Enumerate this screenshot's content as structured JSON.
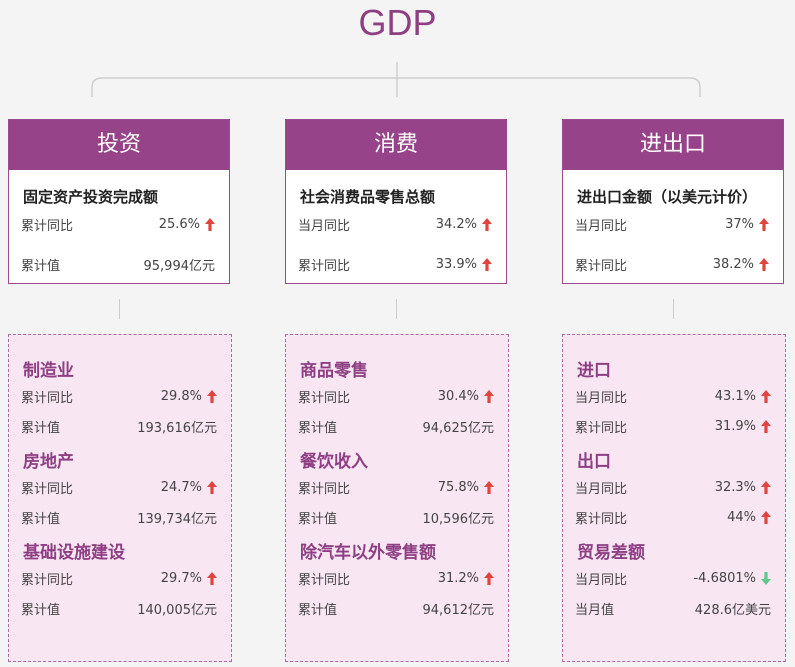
{
  "title": "GDP",
  "colors": {
    "accent": "#97438a",
    "up": "#e0443f",
    "down": "#5fc98a",
    "panel_bg": "#f9e6f3"
  },
  "columns": [
    {
      "header": "投资",
      "card_title": "固定资产投资完成额",
      "rows": [
        {
          "label": "累计同比",
          "value": "25.6%",
          "trend": "up"
        },
        {
          "label": "累计值",
          "value": "95,994亿元",
          "trend": ""
        }
      ],
      "sections": [
        {
          "title": "制造业",
          "rows": [
            {
              "label": "累计同比",
              "value": "29.8%",
              "trend": "up"
            },
            {
              "label": "累计值",
              "value": "193,616亿元",
              "trend": ""
            }
          ]
        },
        {
          "title": "房地产",
          "rows": [
            {
              "label": "累计同比",
              "value": "24.7%",
              "trend": "up"
            },
            {
              "label": "累计值",
              "value": "139,734亿元",
              "trend": ""
            }
          ]
        },
        {
          "title": "基础设施建设",
          "rows": [
            {
              "label": "累计同比",
              "value": "29.7%",
              "trend": "up"
            },
            {
              "label": "累计值",
              "value": "140,005亿元",
              "trend": ""
            }
          ]
        }
      ]
    },
    {
      "header": "消费",
      "card_title": "社会消费品零售总额",
      "rows": [
        {
          "label": "当月同比",
          "value": "34.2%",
          "trend": "up"
        },
        {
          "label": "累计同比",
          "value": "33.9%",
          "trend": "up"
        }
      ],
      "sections": [
        {
          "title": "商品零售",
          "rows": [
            {
              "label": "累计同比",
              "value": "30.4%",
              "trend": "up"
            },
            {
              "label": "累计值",
              "value": "94,625亿元",
              "trend": ""
            }
          ]
        },
        {
          "title": "餐饮收入",
          "rows": [
            {
              "label": "累计同比",
              "value": "75.8%",
              "trend": "up"
            },
            {
              "label": "累计值",
              "value": "10,596亿元",
              "trend": ""
            }
          ]
        },
        {
          "title": "除汽车以外零售额",
          "rows": [
            {
              "label": "累计同比",
              "value": "31.2%",
              "trend": "up"
            },
            {
              "label": "累计值",
              "value": "94,612亿元",
              "trend": ""
            }
          ]
        }
      ]
    },
    {
      "header": "进出口",
      "card_title": "进出口金额（以美元计价）",
      "rows": [
        {
          "label": "当月同比",
          "value": "37%",
          "trend": "up"
        },
        {
          "label": "累计同比",
          "value": "38.2%",
          "trend": "up"
        }
      ],
      "sections": [
        {
          "title": "进口",
          "rows": [
            {
              "label": "当月同比",
              "value": "43.1%",
              "trend": "up"
            },
            {
              "label": "累计同比",
              "value": "31.9%",
              "trend": "up"
            }
          ]
        },
        {
          "title": "出口",
          "rows": [
            {
              "label": "当月同比",
              "value": "32.3%",
              "trend": "up"
            },
            {
              "label": "累计同比",
              "value": "44%",
              "trend": "up"
            }
          ]
        },
        {
          "title": "贸易差额",
          "rows": [
            {
              "label": "当月同比",
              "value": "-4.6801%",
              "trend": "down"
            },
            {
              "label": "当月值",
              "value": "428.6亿美元",
              "trend": ""
            }
          ]
        }
      ]
    }
  ]
}
